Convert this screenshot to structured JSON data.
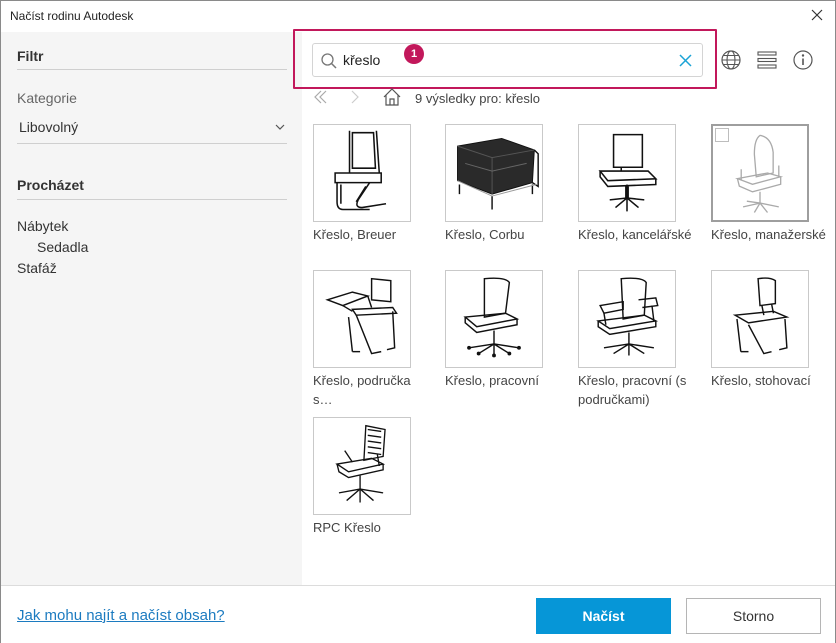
{
  "window": {
    "title": "Načíst rodinu Autodesk"
  },
  "sidebar": {
    "filter_heading": "Filtr",
    "category_label": "Kategorie",
    "category_value": "Libovolný",
    "browse_heading": "Procházet",
    "browse_items": [
      {
        "label": "Nábytek"
      },
      {
        "label": "Sedadla"
      },
      {
        "label": "Stafáž"
      }
    ]
  },
  "search": {
    "value": "křeslo",
    "badge": "1"
  },
  "results": {
    "summary": "9 výsledky pro: křeslo"
  },
  "items": [
    {
      "caption": "Křeslo, Breuer",
      "icon": "breuer-chair"
    },
    {
      "caption": "Křeslo, Corbu",
      "icon": "corbu-armchair"
    },
    {
      "caption": "Křeslo, kancelářské",
      "icon": "office-chair"
    },
    {
      "caption": "Křeslo, manažerské",
      "icon": "executive-chair"
    },
    {
      "caption": "Křeslo, područka s…",
      "icon": "tablet-arm-chair"
    },
    {
      "caption": "Křeslo, pracovní",
      "icon": "task-chair"
    },
    {
      "caption": "Křeslo, pracovní (s područkami)",
      "icon": "task-chair-arms"
    },
    {
      "caption": "Křeslo, stohovací",
      "icon": "stacking-chair"
    },
    {
      "caption": "RPC Křeslo",
      "icon": "rpc-chair"
    }
  ],
  "footer": {
    "help_link": "Jak mohu najít a načíst obsah?",
    "load_button": "Načíst",
    "cancel_button": "Storno"
  },
  "colors": {
    "accent": "#0696d7",
    "highlight": "#c2185b",
    "link": "#1c7bc0"
  }
}
